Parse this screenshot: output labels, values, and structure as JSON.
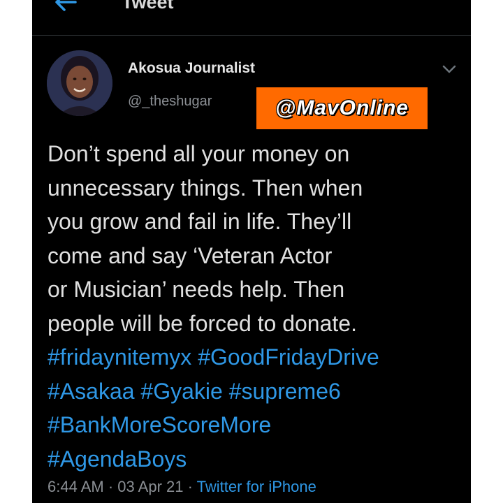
{
  "header": {
    "title": "Tweet",
    "back_icon": "back-arrow-icon"
  },
  "author": {
    "name": "Akosua Journalist",
    "handle": "@_theshugar",
    "avatar": "profile-photo"
  },
  "watermark": {
    "text": "@MavOnline",
    "color": "#ff6a00"
  },
  "tweet": {
    "text_lines": [
      "Don’t spend all your money on",
      "unnecessary things. Then when",
      "you grow and fail in life. They’ll",
      "come and say ‘Veteran Actor",
      "or Musician’ needs help. Then",
      "people will be forced to donate."
    ],
    "hashtag_lines": [
      [
        "#fridaynitemyx",
        "#GoodFridayDrive"
      ],
      [
        "#Asakaa",
        "#Gyakie",
        "#supreme6"
      ],
      [
        "#BankMoreScoreMore"
      ],
      [
        "#AgendaBoys"
      ]
    ],
    "time": "6:44 AM",
    "date": "03 Apr 21",
    "separator": "·",
    "source": "Twitter for iPhone"
  },
  "colors": {
    "background": "#000000",
    "text": "#e0e0e0",
    "link": "#2f98e6",
    "muted": "#8b8f94"
  }
}
